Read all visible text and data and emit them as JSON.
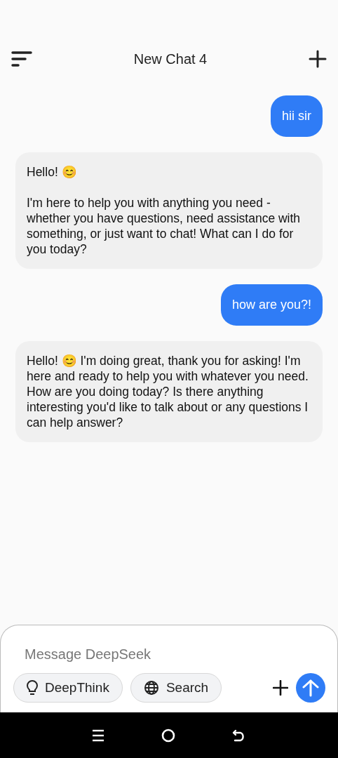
{
  "header": {
    "title": "New Chat 4"
  },
  "messages": [
    {
      "kind": "user",
      "paragraphs": [
        "hii sir"
      ]
    },
    {
      "kind": "assistant",
      "paragraphs": [
        "Hello! 😊",
        "I'm here to help you with anything you need - whether you have questions, need assistance with something, or just want to chat! What can I do for you today?"
      ]
    },
    {
      "kind": "user",
      "paragraphs": [
        "how are you?!"
      ]
    },
    {
      "kind": "assistant",
      "paragraphs": [
        "Hello! 😊 I'm doing great, thank you for asking! I'm here and ready to help you with whatever you need. How are you doing today? Is there anything interesting you'd like to talk about or any questions I can help answer?"
      ]
    }
  ],
  "composer": {
    "placeholder": "Message DeepSeek",
    "toggles": [
      {
        "kind": "deepthink",
        "label": "DeepThink",
        "selected": false
      },
      {
        "kind": "search",
        "label": "Search",
        "selected": false
      }
    ]
  }
}
